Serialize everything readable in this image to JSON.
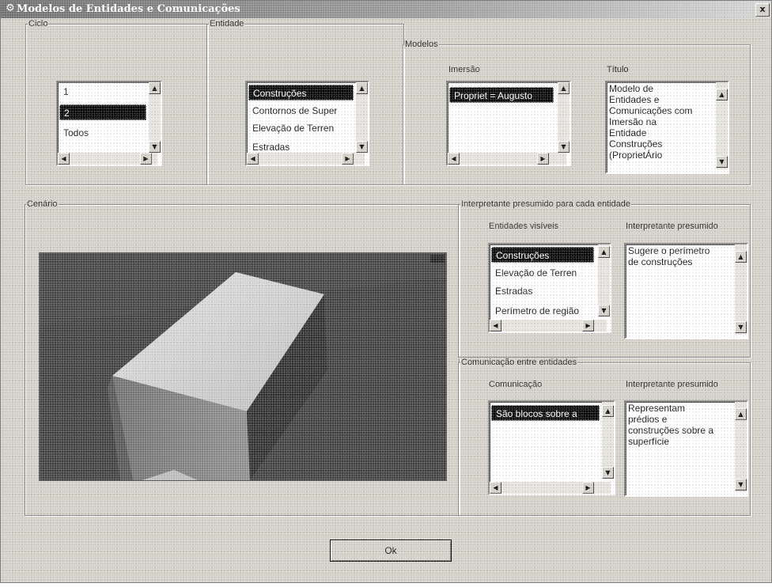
{
  "window": {
    "title": "Modelos de Entidades e Comunicações",
    "icon": "app-icon",
    "close_label": "x"
  },
  "groups": {
    "ciclo": "Ciclo",
    "entidade": "Entidade",
    "modelos": "Modelos",
    "cenario": "Cenário",
    "interpretante": "Interpretante presumido para cada entidade",
    "comunicacao": "Comunicação entre entidades"
  },
  "ciclo": {
    "items": [
      "1",
      "2",
      "Todos"
    ],
    "selected": "2"
  },
  "entidade": {
    "items": [
      "Construções",
      "Contornos de Super",
      "Elevação de Terren",
      "Estradas"
    ],
    "selected": "Construções"
  },
  "modelos": {
    "imersao_label": "Imersão",
    "imersao_items": [
      "Propriet = Augusto"
    ],
    "titulo_label": "Título",
    "titulo_text": "Modelo de\nEntidades e\nComunicações com\nImersão na\nEntidade\nConstruções\n(ProprietÁrio"
  },
  "interpretante": {
    "entidades_label": "Entidades visíveis",
    "entidades_items": [
      "Construções",
      "Elevação de Terren",
      "Estradas",
      "Perímetro de região"
    ],
    "selected": "Construções",
    "presumido_label": "Interpretante presumido",
    "presumido_text": "Sugere o perímetro\nde construções"
  },
  "comunicacao": {
    "comunicacao_label": "Comunicação",
    "items": [
      "São blocos sobre a"
    ],
    "presumido_label": "Interpretante presumido",
    "presumido_text": "Representam\nprédios e\nconstruções sobre a\nsuperfície"
  },
  "ok_label": "Ok",
  "colors": {
    "selection": "#000000",
    "face": "#d4d0c8",
    "scene": "#3c3c3c"
  }
}
